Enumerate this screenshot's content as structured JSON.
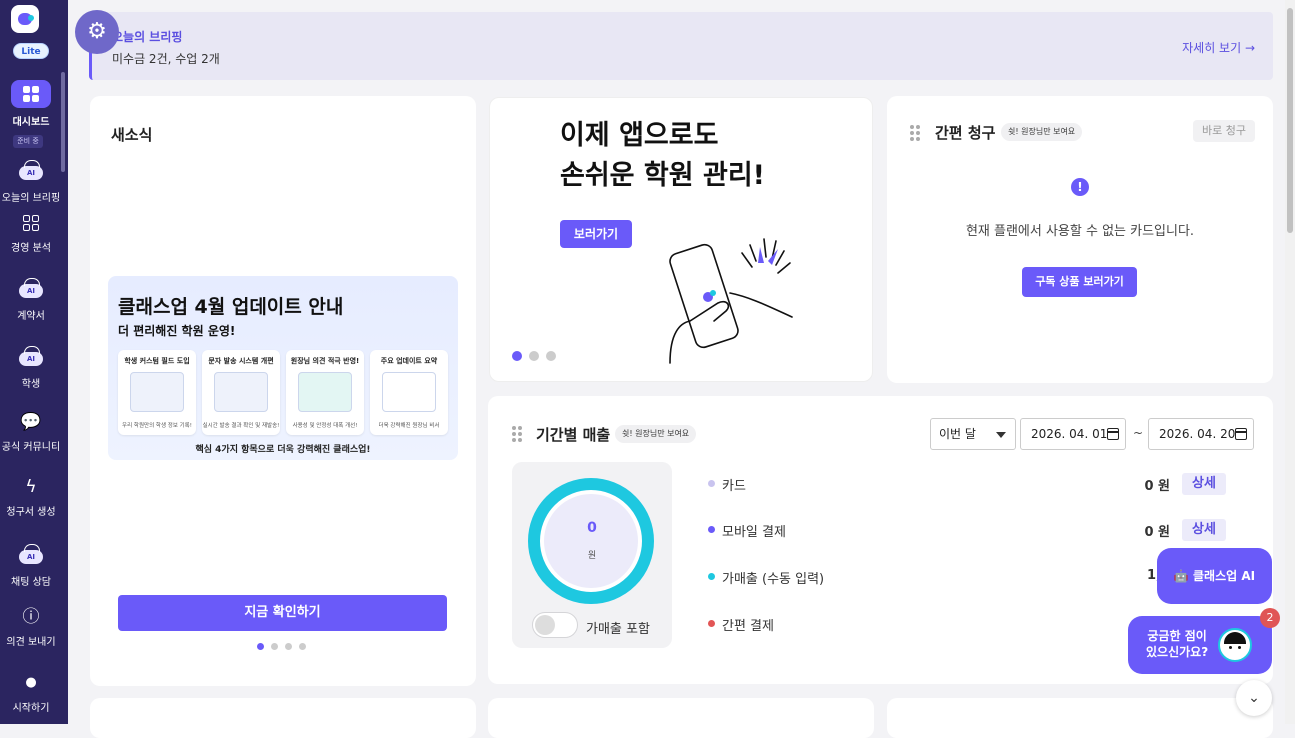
{
  "sidebar": {
    "badge": "Lite",
    "subtag": "준비 중",
    "items": [
      {
        "label": "대시보드",
        "icon": "dashboard-icon"
      },
      {
        "label": "오늘의 브리핑",
        "icon": "ai-badge-icon",
        "badge": "AI"
      },
      {
        "label": "경영 분석",
        "icon": "grid-icon"
      },
      {
        "label": "계약서",
        "icon": "ai-contract-icon",
        "badge": "AI"
      },
      {
        "label": "학생",
        "icon": "ai-student-icon",
        "badge": "AI"
      },
      {
        "label": "공식 커뮤니티",
        "icon": "chat-bubble-icon"
      },
      {
        "label": "청구서 생성",
        "icon": "lightning-icon"
      },
      {
        "label": "채팅 상담",
        "icon": "ai-chat-icon",
        "badge": "AI"
      },
      {
        "label": "의견 보내기",
        "icon": "feedback-icon"
      },
      {
        "label": "시작하기",
        "icon": "start-icon"
      }
    ]
  },
  "briefing": {
    "title": "오늘의 브리핑",
    "summary": "미수금 2건, 수업 2개",
    "more": "자세히 보기 →"
  },
  "news": {
    "title": "새소식",
    "banner": {
      "headline": "클래스업 4월 업데이트 안내",
      "subhead": "더 편리해진 학원 운영!",
      "cards": [
        {
          "title": "학생 커스텀 필드 도입",
          "caption": "우리 학원만의 학생 정보 기록!"
        },
        {
          "title": "문자 발송 시스템 개편",
          "caption": "실시간 발송 결과 확인 및 재발송!"
        },
        {
          "title": "원장님 의견 적극 반영!",
          "caption": "사용성 및 안정성 대폭 개선!"
        },
        {
          "title": "주요 업데이트 요약",
          "caption": "더욱 강력해진 원장님 비서"
        }
      ],
      "footer": "핵심 4가지 항목으로 더욱 강력해진 클래스업!"
    },
    "cta": "지금 확인하기"
  },
  "app_promo": {
    "line1": "이제 앱으로도",
    "line2": "손쉬운 학원 관리!",
    "button": "보러가기"
  },
  "quick_bill": {
    "title": "간편 청구",
    "tag": "쉿! 원장님만 보여요",
    "button": "바로 청구",
    "message": "현재 플랜에서 사용할 수 없는 카드입니다.",
    "cta": "구독 상품 보러가기"
  },
  "sales": {
    "title": "기간별 매출",
    "tag": "쉿! 원장님만 보여요",
    "period": "이번 달",
    "date_from": "2026. 04. 01",
    "date_to": "2026. 04. 20",
    "separator": "~",
    "total": "0",
    "unit": "원",
    "toggle_label": "가매출 포함",
    "rows": [
      {
        "label": "카드",
        "value": "0 원",
        "detail": "상세",
        "color": "#c9c4ef"
      },
      {
        "label": "모바일 결제",
        "value": "0 원",
        "detail": "상세",
        "color": "#6a5af9"
      },
      {
        "label": "가매출 (수동 입력)",
        "value": "1,0",
        "detail": "",
        "color": "#1ec8e0"
      },
      {
        "label": "간편 결제",
        "value": "",
        "detail": "",
        "color": "#e25555"
      }
    ]
  },
  "fab": {
    "ai_label": "클래스업 AI",
    "help_line1": "궁금한 점이",
    "help_line2": "있으신가요?",
    "notif_count": "2"
  },
  "colors": {
    "accent": "#6a5af9",
    "sidebar": "#2b2560",
    "cyan": "#1ec8e0"
  }
}
